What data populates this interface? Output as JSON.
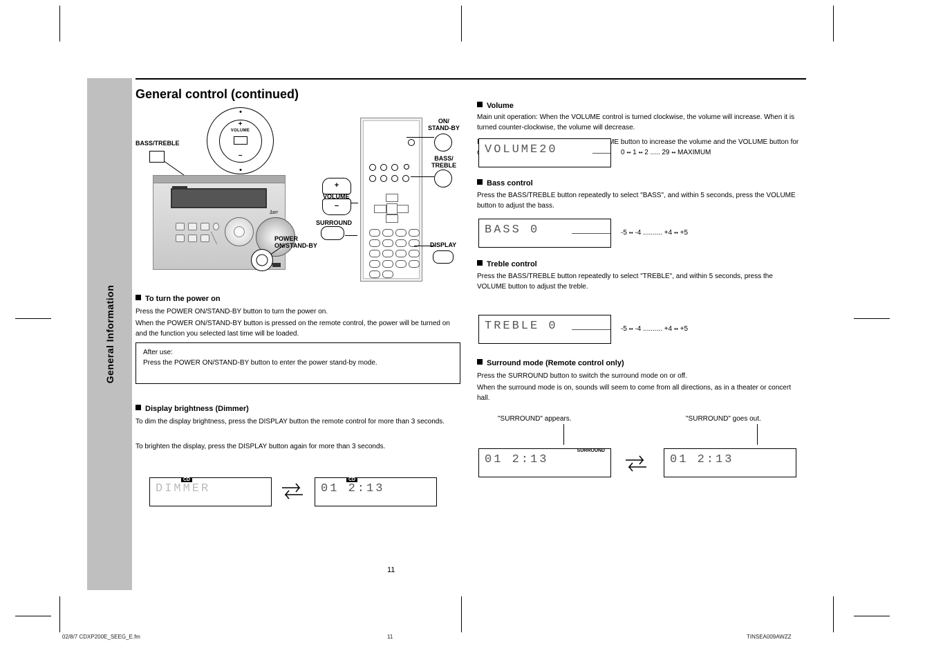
{
  "page_title": "General control (continued)",
  "sidebar_text": "General Information",
  "page_number": "11",
  "footer_code": "02/8/7   CDXP200E_SEEG_E.fm",
  "footer_date": "TINSEA009AWZZ",
  "illustration": {
    "bass_treble_label": "BASS/TREBLE",
    "volume_dial_label": "VOLUME",
    "on_standby_label": "ON/\nSTAND-BY",
    "bass_treble_remote_label": "BASS/\nTREBLE",
    "volume_remote_label": "VOLUME",
    "surround_remote_label": "SURROUND",
    "display_remote_label": "DISPLAY",
    "power_label": "POWER\nON/STAND-BY"
  },
  "sections": {
    "power_on": {
      "heading": "To turn the power on",
      "body": "Press the POWER ON/STAND-BY button to turn the power on.",
      "note": "After use:\nPress the POWER ON/STAND-BY button to enter the power stand-by mode."
    },
    "brightness": {
      "heading": "Display brightness (Dimmer)",
      "body1": "To dim the display brightness, press the DISPLAY button the remote control for more than 3 seconds.",
      "body2": "To brighten the display, press the DISPLAY button again for more than 3 seconds."
    },
    "volume": {
      "heading": "Volume",
      "body_main": "Main unit operation:\nWhen the VOLUME control is turned clockwise, the volume will increase. When it is turned counter-clockwise, the volume will decrease.",
      "body_remote": "Remote control operation:\nPress the VOLUME    button to increase the volume and the VOLUME    button for decreasing.",
      "annot": "0    1    2 ..... 29    MAXIMUM"
    },
    "bass": {
      "heading": "Bass control",
      "body": "Press the BASS/TREBLE button repeatedly to select \"BASS\", and within 5 seconds, press the VOLUME button to adjust the bass.",
      "annot": "-5    -4 .......... +4    +5"
    },
    "treble": {
      "heading": "Treble control",
      "body": "Press the BASS/TREBLE button repeatedly to select \"TREBLE\", and within 5 seconds, press the VOLUME button to adjust the treble.",
      "annot": "-5    -4 .......... +4    +5"
    },
    "surround": {
      "heading": "Surround mode (Remote control only)",
      "body1": "Press the SURROUND button to switch the surround mode on or off.",
      "body2": "When the surround mode is on, sounds will seem to come from all directions, as in a theater or concert hall.",
      "annot_on": "\"SURROUND\" appears.",
      "annot_off": "\"SURROUND\" goes out."
    }
  },
  "lcd": {
    "volume": "VOLUME20",
    "bass": "BASS   0",
    "treble": "TREBLE 0",
    "dimmer": "DIMMER",
    "cd_play": "01    2:13",
    "surround_badge": "SURROUND",
    "cd_badge": "CD"
  }
}
